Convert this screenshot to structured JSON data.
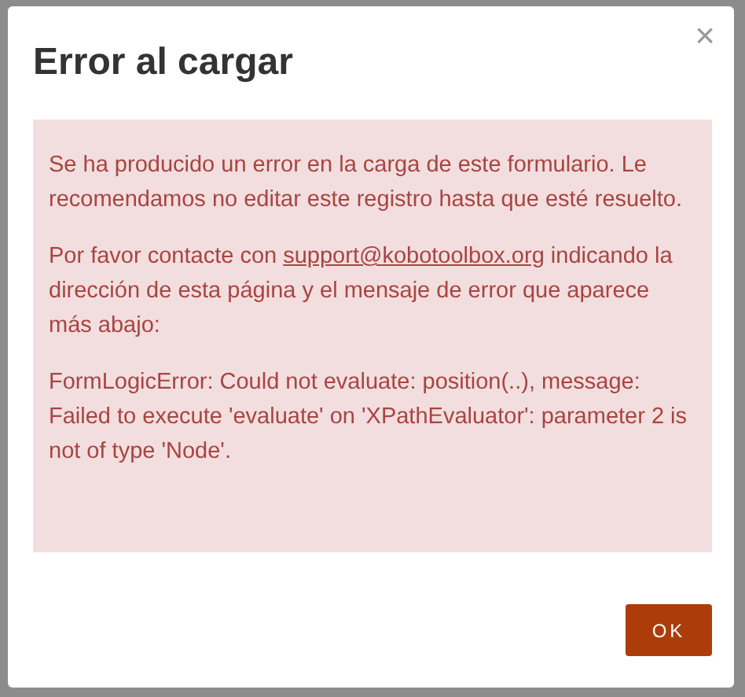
{
  "dialog": {
    "title": "Error al cargar",
    "close": "×",
    "message": [
      {
        "text": "Se ha producido un error en la carga de este formulario. Le recomendamos no editar este registro hasta que esté resuelto."
      },
      {
        "text": "Por favor contacte con",
        "link": "support@kobotoolbox.org",
        "after": "indicando la dirección de esta página y el mensaje de error que aparece más abajo:"
      },
      {
        "text": "FormLogicError: Could not evaluate: position(..), message: Failed to execute 'evaluate' on 'XPathEvaluator': parameter 2 is not of type 'Node'."
      }
    ],
    "buttons": [
      "OK"
    ]
  }
}
